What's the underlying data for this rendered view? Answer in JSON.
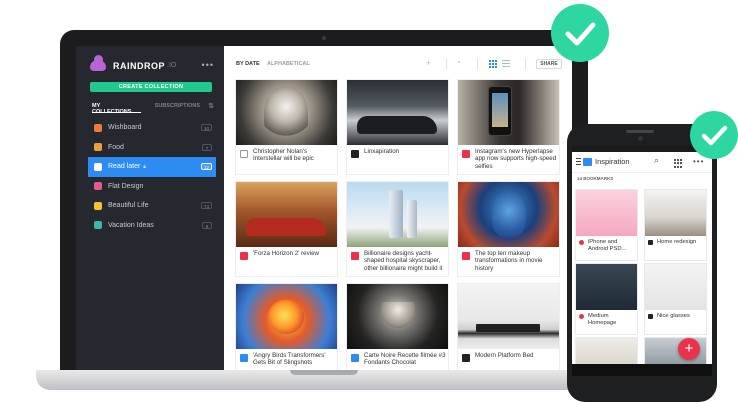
{
  "colors": {
    "accent_blue": "#2c8cf4",
    "accent_green": "#21c98f",
    "check_green": "#2ed6a2",
    "sidebar_bg": "#25282e",
    "fab_red": "#e8334a"
  },
  "app": {
    "brand_name": "RAINDROP",
    "brand_suffix": ".IO",
    "more_icon": "more-dots-icon"
  },
  "sidebar": {
    "create_label": "CREATE COLLECTION",
    "tabs": [
      {
        "label": "MY COLLECTIONS",
        "active": true
      },
      {
        "label": "SUBSCRIPTIONS",
        "active": false
      }
    ],
    "sort_icon": "sort-icon",
    "collections": [
      {
        "label": "Wishboard",
        "count": "10",
        "icon_color": "#f07a3a",
        "active": false
      },
      {
        "label": "Food",
        "count": "7",
        "icon_color": "#e9a23b",
        "active": false
      },
      {
        "label": "Read later",
        "count": "12",
        "icon_color": "#ffffff",
        "active": true,
        "locked": true
      },
      {
        "label": "Flat Design",
        "count": "",
        "icon_color": "#e25a8e",
        "active": false
      },
      {
        "label": "Beautiful Life",
        "count": "74",
        "icon_color": "#f2c230",
        "active": false
      },
      {
        "label": "Vacation Ideas",
        "count": "9",
        "icon_color": "#3fb6a6",
        "active": false
      }
    ]
  },
  "toolbar": {
    "sort_options": [
      {
        "label": "BY DATE",
        "active": true
      },
      {
        "label": "ALPHABETICAL",
        "active": false
      }
    ],
    "share_label": "SHARE"
  },
  "bookmarks": [
    {
      "title": "Christopher Nolan's Interstellar will be epic",
      "favicon_color": "#ffffff",
      "thumb": "t1"
    },
    {
      "title": "Linxapiration",
      "favicon_color": "#222222",
      "thumb": "t2"
    },
    {
      "title": "Instagram's new Hyperlapse app now supports high-speed selfies",
      "favicon_color": "#e8334a",
      "thumb": "t3"
    },
    {
      "title": "'Forza Horizon 2' review",
      "favicon_color": "#e8334a",
      "thumb": "t4"
    },
    {
      "title": "Billionaire designs yacht-shaped hospital skyscraper, other billionaire might build it",
      "favicon_color": "#e8334a",
      "thumb": "t5"
    },
    {
      "title": "The top ten makeup transformations in movie history",
      "favicon_color": "#e8334a",
      "thumb": "t6"
    },
    {
      "title": "'Angry Birds Transformers' Gets Bit of Slingshots",
      "favicon_color": "#2c8cf4",
      "thumb": "t7"
    },
    {
      "title": "Carte Noire Recette filmée #3 Fondants Chocolat",
      "favicon_color": "#2c8cf4",
      "thumb": "t8"
    },
    {
      "title": "Modern Platform Bed",
      "favicon_color": "#222222",
      "thumb": "t9"
    }
  ],
  "phone": {
    "title": "Inspiration",
    "count_label": "14 BOOKMARKS",
    "fab_label": "+",
    "items": [
      {
        "title": "iPhone and Android PSD...",
        "favicon_color": "#e8334a",
        "thumb": "pt1",
        "round": true
      },
      {
        "title": "Home redesign",
        "favicon_color": "#222222",
        "thumb": "pt2",
        "round": false
      },
      {
        "title": "Medium Homepage",
        "favicon_color": "#e8334a",
        "thumb": "pt3",
        "round": true
      },
      {
        "title": "Nice glasses",
        "favicon_color": "#222222",
        "thumb": "pt4",
        "round": false
      },
      {
        "title": "",
        "favicon_color": "",
        "thumb": "pt5",
        "round": true
      },
      {
        "title": "",
        "favicon_color": "",
        "thumb": "pt6",
        "round": false
      }
    ]
  }
}
